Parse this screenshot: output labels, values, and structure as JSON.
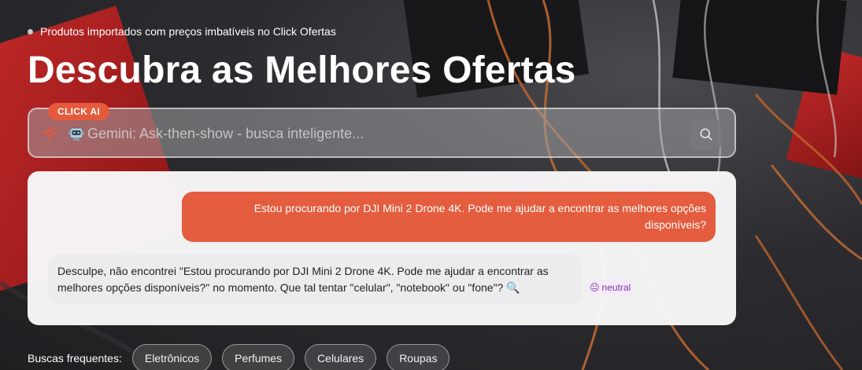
{
  "hero": {
    "tagline": "Produtos importados com preços imbatíveis no Click Ofertas",
    "title": "Descubra as Melhores Ofertas"
  },
  "search": {
    "badge": "CLICK AI",
    "placeholder": "Gemini: Ask-then-show - busca inteligente...",
    "icons": [
      "sparkle-icon",
      "robot-icon",
      "search-icon"
    ]
  },
  "chat": {
    "user_message": "Estou procurando por DJI Mini 2 Drone 4K. Pode me ajudar a encontrar as melhores opções disponíveis?",
    "bot_message": "Desculpe, não encontrei \"Estou procurando por DJI Mini 2 Drone 4K. Pode me ajudar a encontrar as melhores opções disponíveis?\" no momento. Que tal tentar \"celular\", \"notebook\" ou \"fone\"? 🔍",
    "sentiment": "neutral",
    "sentiment_emoji": "😐"
  },
  "frequent": {
    "label": "Buscas frequentes:",
    "chips": [
      "Eletrônicos",
      "Perfumes",
      "Celulares",
      "Roupas"
    ]
  },
  "colors": {
    "accent": "#e45d3e",
    "sentiment_text": "#7b3aa8"
  }
}
